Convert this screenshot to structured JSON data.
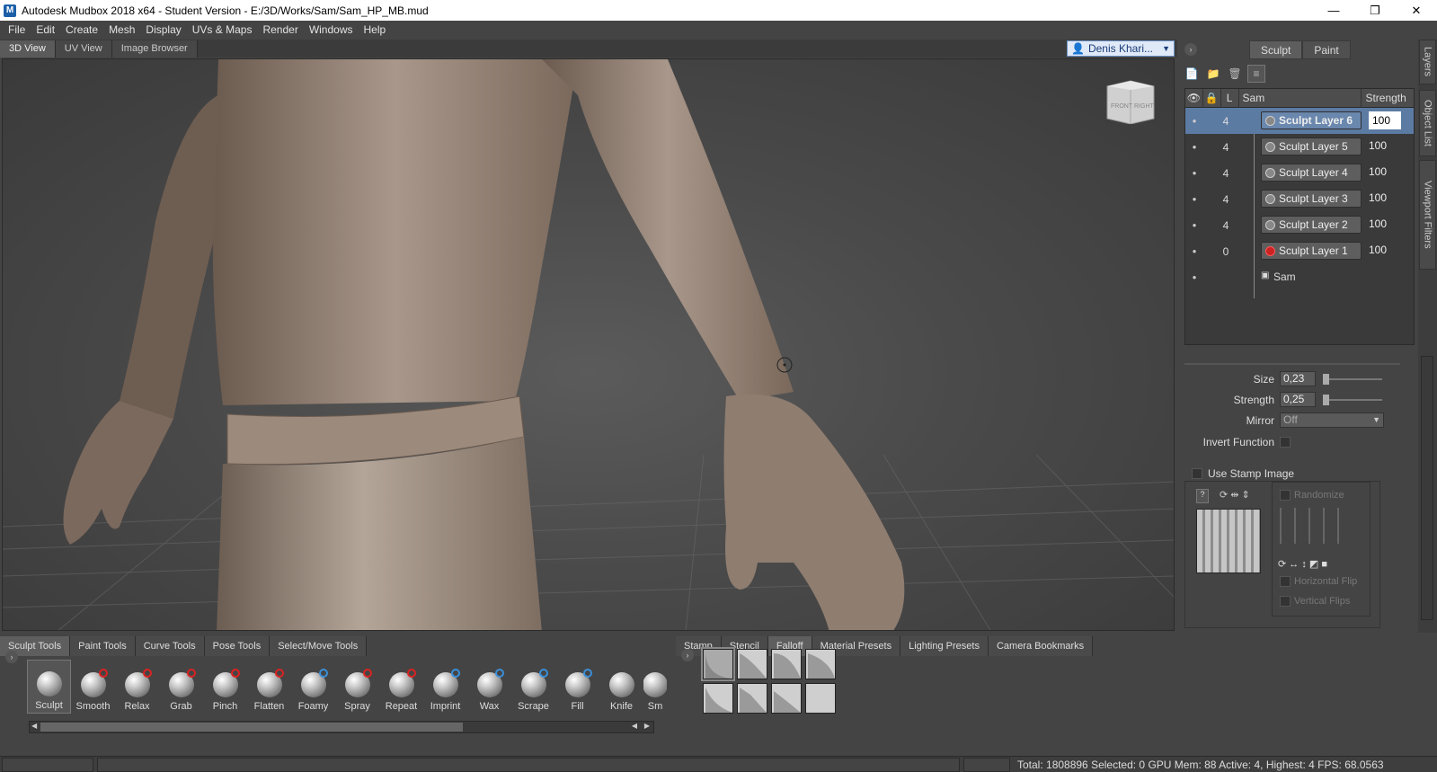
{
  "window": {
    "title": "Autodesk Mudbox 2018 x64 - Student Version - E:/3D/Works/Sam/Sam_HP_MB.mud",
    "app_icon_letter": "M",
    "controls": {
      "minimize": "—",
      "maximize": "❐",
      "close": "✕"
    }
  },
  "menu": [
    "File",
    "Edit",
    "Create",
    "Mesh",
    "Display",
    "UVs & Maps",
    "Render",
    "Windows",
    "Help"
  ],
  "view_tabs": [
    "3D View",
    "UV View",
    "Image Browser"
  ],
  "user": {
    "name": "Denis Khari..."
  },
  "viewcube": {
    "left": "FRONT",
    "right": "RIGHT"
  },
  "panel": {
    "tabs": [
      "Sculpt",
      "Paint"
    ],
    "layers_header": {
      "name_col": "Sam",
      "strength_col": "Strength",
      "lock_col": "L"
    },
    "layers": [
      {
        "count": "4",
        "name": "Sculpt Layer 6",
        "strength": "100",
        "selected": true
      },
      {
        "count": "4",
        "name": "Sculpt Layer 5",
        "strength": "100"
      },
      {
        "count": "4",
        "name": "Sculpt Layer 4",
        "strength": "100"
      },
      {
        "count": "4",
        "name": "Sculpt Layer 3",
        "strength": "100"
      },
      {
        "count": "4",
        "name": "Sculpt Layer 2",
        "strength": "100"
      },
      {
        "count": "0",
        "name": "Sculpt Layer 1",
        "strength": "100",
        "recording": true
      }
    ],
    "mesh_name": "Sam"
  },
  "properties": {
    "size_label": "Size",
    "size_value": "0,23",
    "strength_label": "Strength",
    "strength_value": "0,25",
    "mirror_label": "Mirror",
    "mirror_value": "Off",
    "invert_label": "Invert Function",
    "stamp_label": "Use Stamp Image",
    "randomize_label": "Randomize",
    "hflip_label": "Horizontal Flip",
    "vflip_label": "Vertical Flips"
  },
  "dock_tabs": [
    "Layers",
    "Object List",
    "Viewport Filters"
  ],
  "tray_tabs_left": [
    "Sculpt Tools",
    "Paint Tools",
    "Curve Tools",
    "Pose Tools",
    "Select/Move Tools"
  ],
  "tray_tabs_right": [
    "Stamp",
    "Stencil",
    "Falloff",
    "Material Presets",
    "Lighting Presets",
    "Camera Bookmarks"
  ],
  "tools": [
    {
      "label": "Sculpt"
    },
    {
      "label": "Smooth"
    },
    {
      "label": "Relax"
    },
    {
      "label": "Grab"
    },
    {
      "label": "Pinch"
    },
    {
      "label": "Flatten"
    },
    {
      "label": "Foamy"
    },
    {
      "label": "Spray"
    },
    {
      "label": "Repeat"
    },
    {
      "label": "Imprint"
    },
    {
      "label": "Wax"
    },
    {
      "label": "Scrape"
    },
    {
      "label": "Fill"
    },
    {
      "label": "Knife"
    },
    {
      "label": "Sm"
    }
  ],
  "status": "Total: 1808896  Selected: 0 GPU Mem: 88  Active: 4, Highest: 4  FPS: 68.0563",
  "colors": {
    "selection": "#5c7ba3",
    "record": "#cc2222",
    "user_box": "#dfe9f7"
  }
}
